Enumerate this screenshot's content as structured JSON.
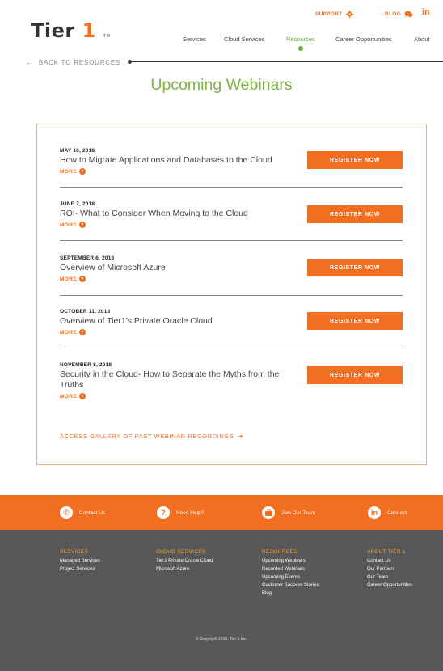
{
  "header": {
    "logo_main": "Tier",
    "logo_num": "1",
    "logo_tm": "TM",
    "support_label": "SUPPORT",
    "blog_label": "BLOG",
    "linkedin_label": "in",
    "nav": [
      "Services",
      "Cloud Services",
      "Resources",
      "Career Opportunities",
      "About"
    ],
    "active_nav": "Resources"
  },
  "back_label": "BACK TO RESOURCES",
  "page_title": "Upcoming Webinars",
  "register_label": "REGISTER NOW",
  "more_label": "MORE",
  "webinars": [
    {
      "date": "MAY 10, 2018",
      "title": "How to Migrate Applications and Databases to the Cloud"
    },
    {
      "date": "JUNE 7, 2018",
      "title": "ROI- What to Consider When Moving to the Cloud"
    },
    {
      "date": "SEPTEMBER 6, 2018",
      "title": "Overview of Microsoft Azure"
    },
    {
      "date": "OCTOBER 11, 2018",
      "title": "Overview of Tier1's Private Oracle Cloud"
    },
    {
      "date": "NOVEMBER 8, 2018",
      "title": "Security in the Cloud- How to Separate the Myths from the Truths"
    }
  ],
  "gallery_label": "ACCESS GALLERY OF PAST WEBINAR RECORDINGS",
  "cta_bar": {
    "contact": "Contact Us",
    "help": "Need Help?",
    "join": "Join Our Team",
    "connect": "Connect"
  },
  "footer": {
    "services": {
      "heading": "SERVICES",
      "items": [
        "Managed Services",
        "Project Services"
      ]
    },
    "cloud": {
      "heading": "CLOUD SERVICES",
      "items": [
        "Tier1 Private Oracle Cloud",
        "Microsoft Azure"
      ]
    },
    "resources": {
      "heading": "RESOURCES",
      "items": [
        "Upcoming Webinars",
        "Recorded Webinars",
        "Upcoming Events",
        "Customer Success Stories",
        "Blog"
      ]
    },
    "about": {
      "heading": "ABOUT TIER 1",
      "items": [
        "Contact Us",
        "Our Partners",
        "Our Team",
        "Career Opportunities"
      ]
    },
    "copyright": "© Copyright 2018, Tier 1 Inc."
  },
  "colors": {
    "accent": "#f26f21",
    "green": "#7cb342",
    "footer": "#58585a"
  }
}
